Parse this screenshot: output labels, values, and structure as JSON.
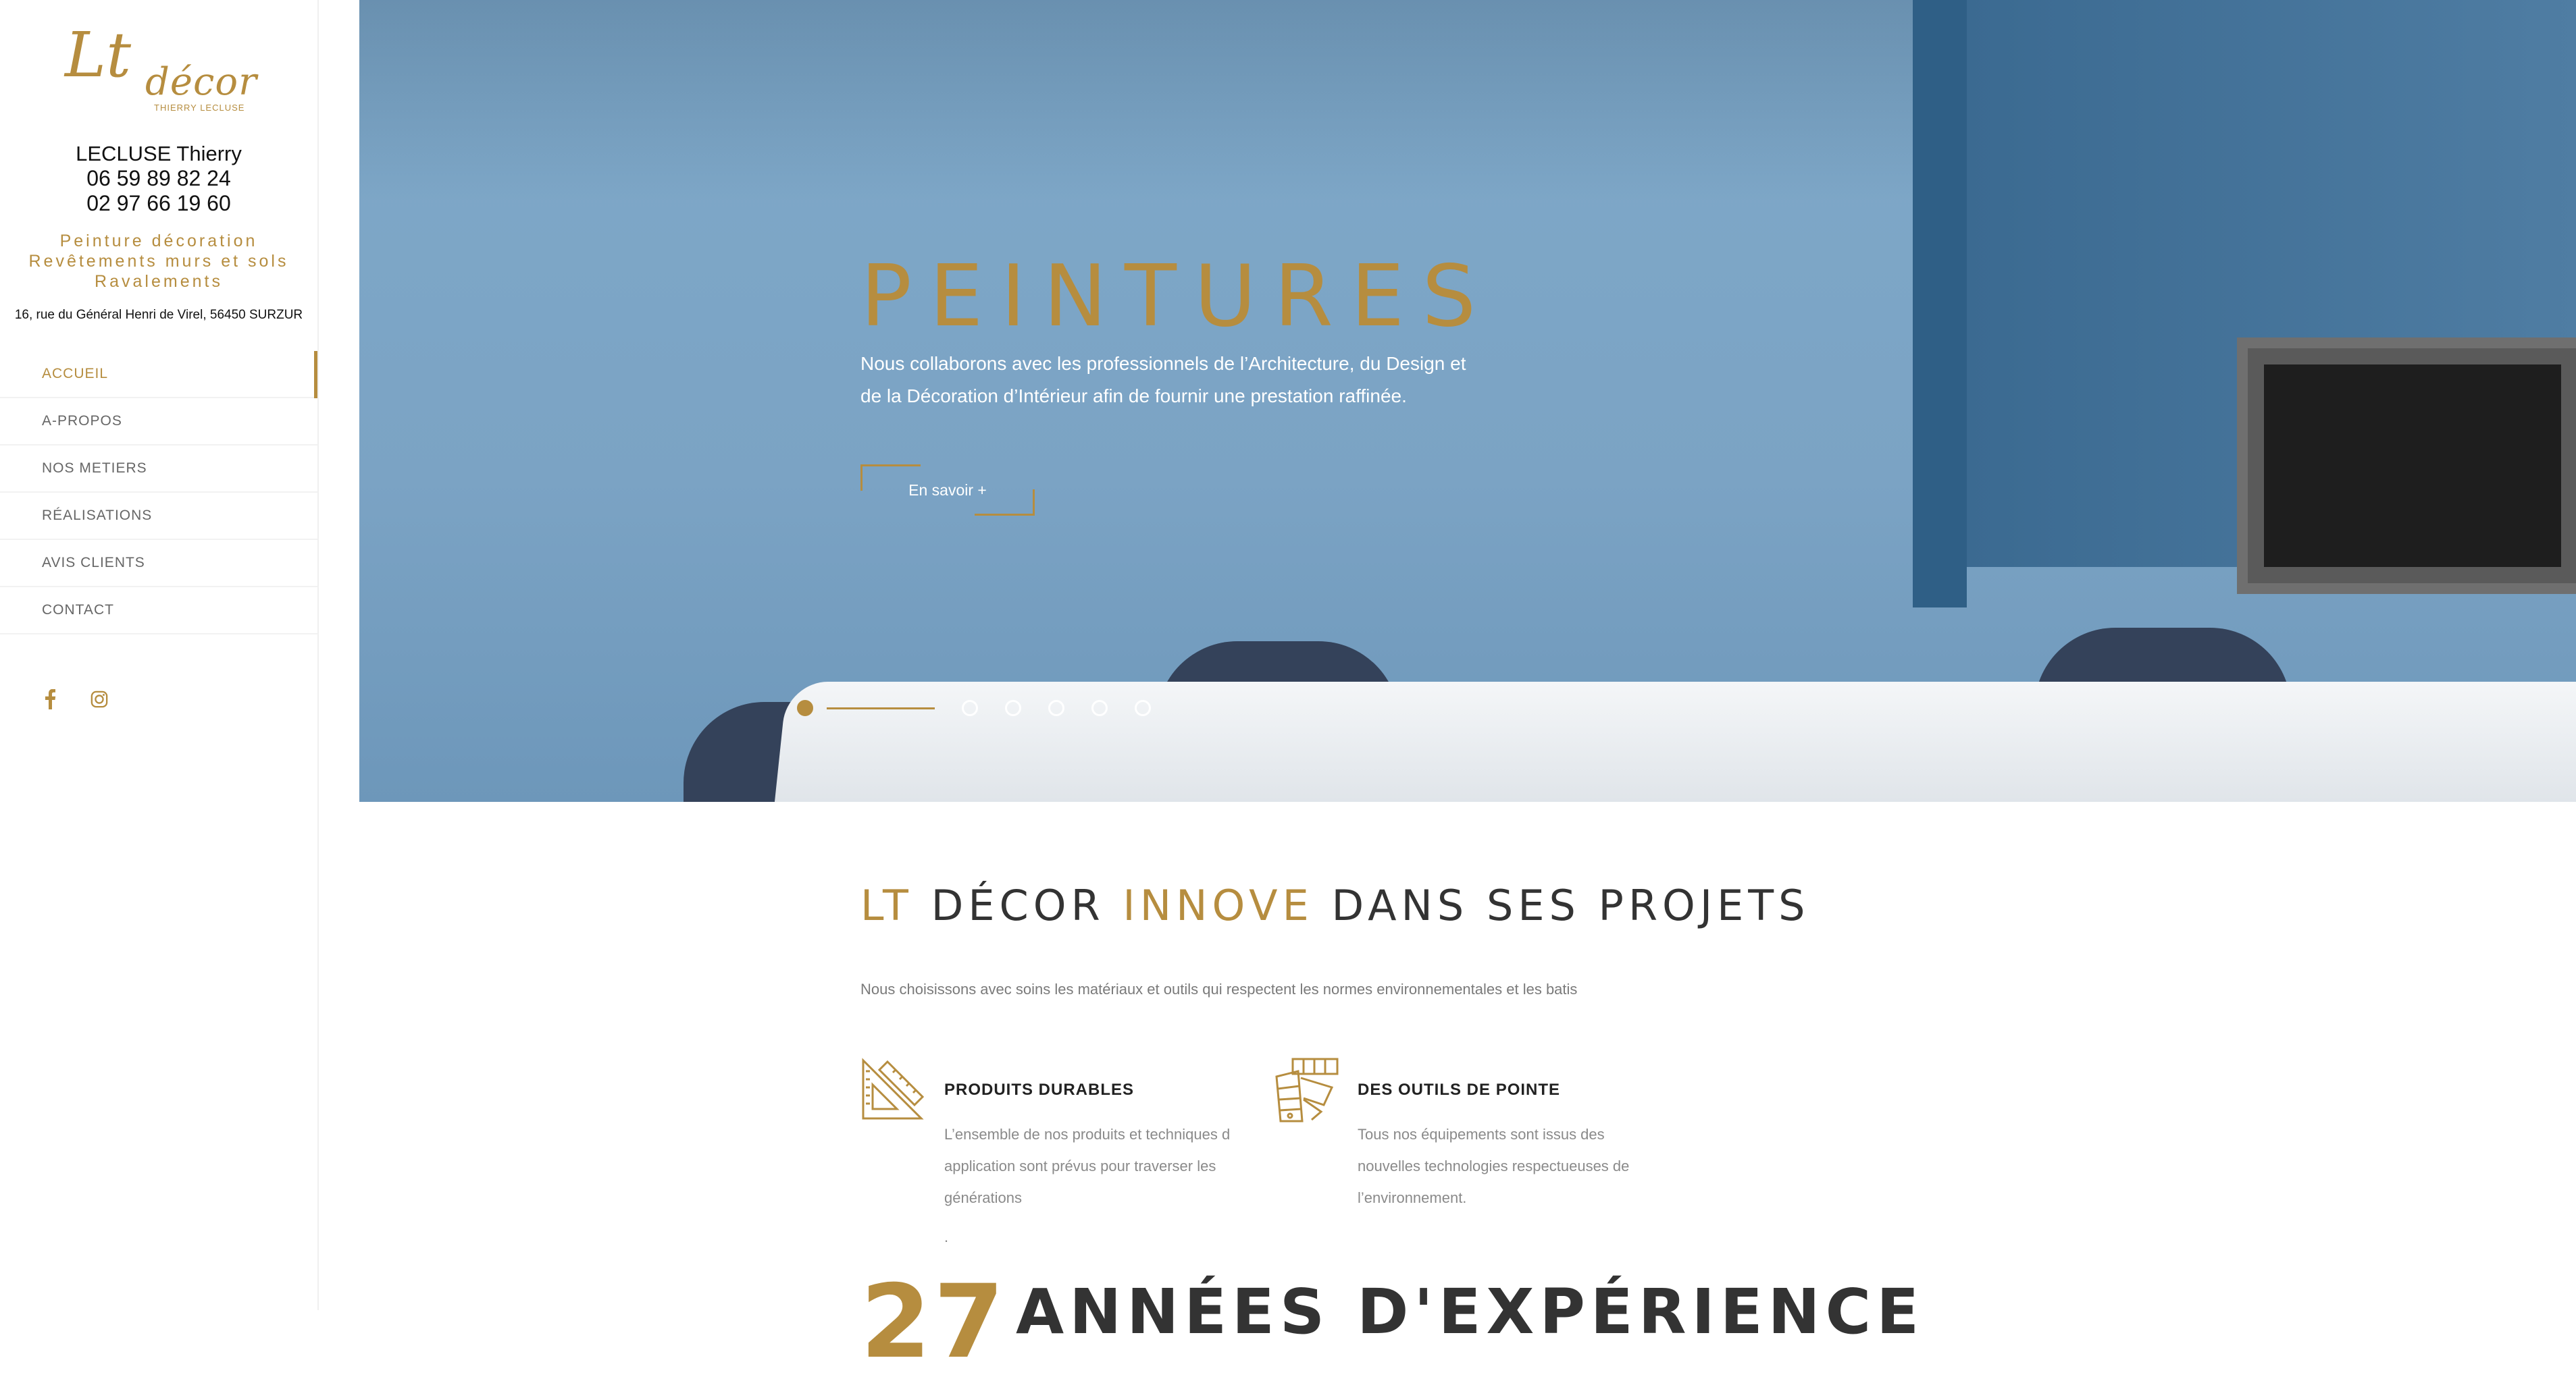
{
  "brand": {
    "logo_script": "Lt",
    "logo_word": "décor",
    "logo_sub": "THIERRY LECLUSE",
    "color_gold": "#b68d3f"
  },
  "contact": {
    "name": "LECLUSE Thierry",
    "phone1": "06 59 89 82 24",
    "phone2": "02 97 66 19 60",
    "services": [
      "Peinture décoration",
      "Revêtements murs et sols",
      "Ravalements"
    ],
    "address": "16, rue du Général Henri de Virel, 56450 SURZUR"
  },
  "nav": {
    "items": [
      {
        "label": "ACCUEIL",
        "active": true
      },
      {
        "label": "A-PROPOS"
      },
      {
        "label": "NOS METIERS"
      },
      {
        "label": "RÉALISATIONS"
      },
      {
        "label": "AVIS CLIENTS"
      },
      {
        "label": "CONTACT"
      }
    ]
  },
  "social": {
    "facebook_icon": "facebook-icon",
    "instagram_icon": "instagram-icon"
  },
  "hero": {
    "title": "PEINTURES",
    "text": "Nous collaborons avec les professionnels de l’Architecture, du Design et de la Décoration d’Intérieur afin de fournir une prestation raffinée.",
    "button": "En savoir +",
    "slides_count": 6,
    "active_slide": 1
  },
  "section": {
    "title_part1": "LT",
    "title_part2": " DÉCOR ",
    "title_part3": "INNOVE",
    "title_part4": " DANS SES PROJETS",
    "desc": "Nous choisissons avec soins les matériaux et outils qui respectent les normes environnementales et les batis"
  },
  "features": [
    {
      "title": "PRODUITS DURABLES",
      "desc": "L’ensemble de nos produits et techniques d application sont prévus pour traverser les générations",
      "icon": "drafting-tools-icon"
    },
    {
      "title": "DES OUTILS DE POINTE",
      "desc": "Tous nos équipements sont issus des nouvelles technologies respectueuses de l’environnement.",
      "icon": "color-swatches-icon"
    }
  ],
  "dot_mark": ".",
  "experience": {
    "number": "27",
    "label": "ANNÉES D'EXPÉRIENCE"
  }
}
